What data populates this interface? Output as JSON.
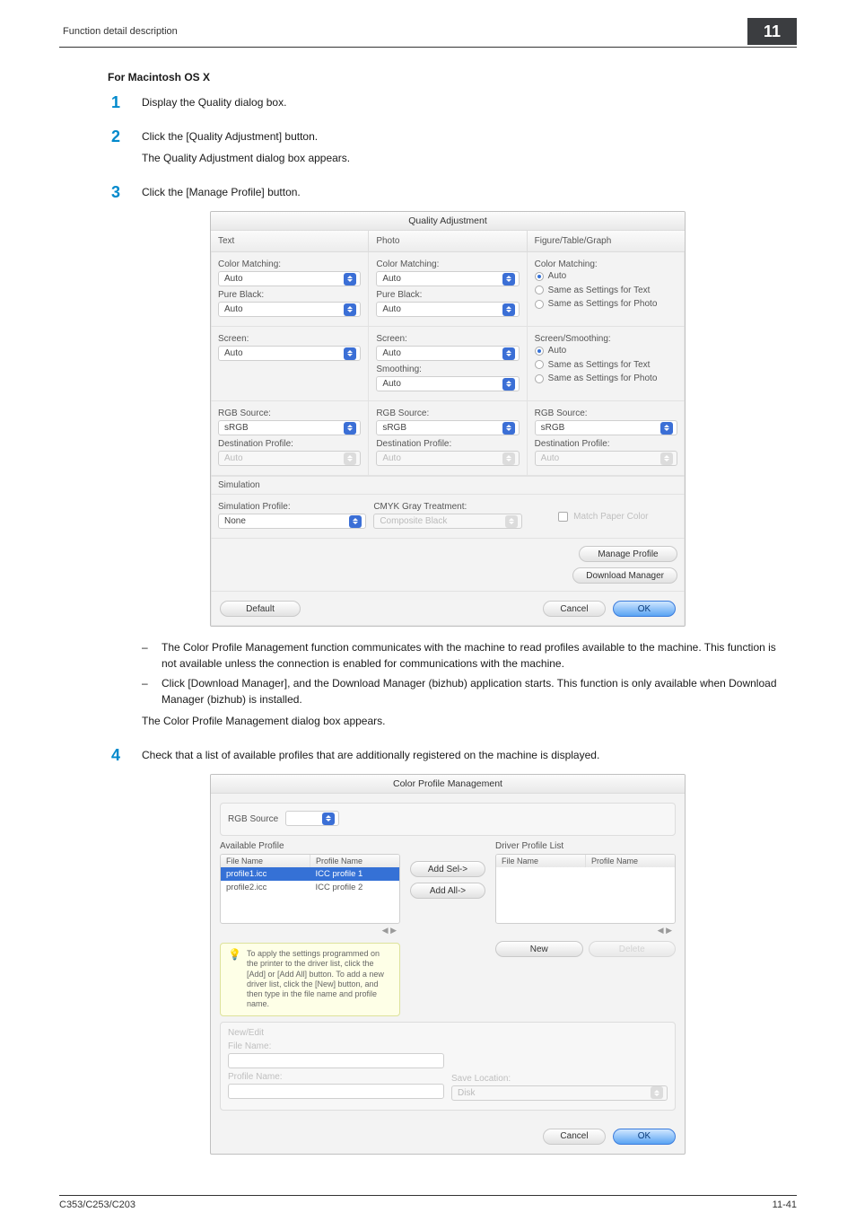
{
  "header": {
    "section_title": "Function detail description",
    "tab_number": "11"
  },
  "subhead": "For Macintosh OS X",
  "steps": {
    "s1": {
      "num": "1",
      "text": "Display the Quality dialog box."
    },
    "s2": {
      "num": "2",
      "text": "Click the [Quality Adjustment] button.",
      "sub": "The Quality Adjustment dialog box appears."
    },
    "s3": {
      "num": "3",
      "text": "Click the [Manage Profile] button.",
      "notes": [
        "The Color Profile Management function communicates with the machine to read profiles available to the machine. This function is not available unless the connection is enabled for communications with the machine.",
        "Click [Download Manager], and the Download Manager (bizhub) application starts. This function is only available when Download Manager (bizhub) is installed."
      ],
      "sub_after": "The Color Profile Management dialog box appears."
    },
    "s4": {
      "num": "4",
      "text": "Check that a list of available profiles that are additionally registered on the machine is displayed."
    }
  },
  "qa": {
    "title": "Quality Adjustment",
    "cols": {
      "text": "Text",
      "photo": "Photo",
      "figure": "Figure/Table/Graph"
    },
    "labels": {
      "color_matching": "Color Matching:",
      "pure_black": "Pure Black:",
      "screen": "Screen:",
      "smoothing": "Smoothing:",
      "rgb_source": "RGB Source:",
      "dest_profile": "Destination Profile:",
      "screen_smoothing": "Screen/Smoothing:"
    },
    "values": {
      "auto": "Auto",
      "srgb": "sRGB",
      "none": "None",
      "composite_black": "Composite Black",
      "same_text": "Same as Settings for Text",
      "same_photo": "Same as Settings for Photo"
    },
    "sim": {
      "heading": "Simulation",
      "profile": "Simulation Profile:",
      "cmyk": "CMYK Gray Treatment:",
      "match_paper": "Match Paper Color"
    },
    "buttons": {
      "manage_profile": "Manage Profile",
      "download_manager": "Download Manager",
      "default": "Default",
      "cancel": "Cancel",
      "ok": "OK"
    }
  },
  "cpm": {
    "title": "Color Profile Management",
    "source_label": "RGB Source",
    "available_profile": "Available Profile",
    "driver_profile_list": "Driver Profile List",
    "columns": {
      "file_name": "File Name",
      "profile_name": "Profile Name"
    },
    "rows": [
      {
        "file": "profile1.icc",
        "name": "ICC profile 1",
        "selected": true
      },
      {
        "file": "profile2.icc",
        "name": "ICC profile 2",
        "selected": false
      }
    ],
    "scroll_hint": "◀ ▶",
    "buttons": {
      "add_sel": "Add Sel->",
      "add_all": "Add All->",
      "new": "New",
      "delete": "Delete",
      "cancel": "Cancel",
      "ok": "OK"
    },
    "panel": {
      "new_edit": "New/Edit",
      "file_name": "File Name:",
      "profile_name": "Profile Name:",
      "save_location": "Save Location:",
      "disk": "Disk"
    },
    "tip": "To apply the settings programmed on the printer to the driver list, click the [Add] or [Add All] button. To add a new driver list, click the [New] button, and then type in the file name and profile name."
  },
  "footer": {
    "model": "C353/C253/C203",
    "page": "11-41"
  }
}
